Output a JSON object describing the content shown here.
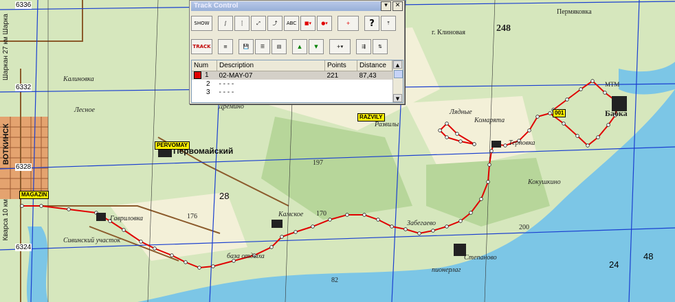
{
  "window": {
    "title": "Track Control",
    "buttons": {
      "show": "SHOW",
      "track": "TRACK",
      "abc": "ABC",
      "help": "?"
    }
  },
  "table": {
    "columns": [
      "Num",
      "Description",
      "Points",
      "Distance"
    ],
    "rows": [
      {
        "num": "1",
        "description": "02-MAY-07",
        "points": "221",
        "distance": "87,43",
        "color": "#e00000"
      },
      {
        "num": "2",
        "description": "- - - -",
        "points": "",
        "distance": ""
      },
      {
        "num": "3",
        "description": "- - - -",
        "points": "",
        "distance": ""
      }
    ]
  },
  "map": {
    "waypoints": {
      "pervomay": "PERVOMAY",
      "magazin": "MAGAZIN",
      "razvily": "RAZVILY",
      "wp001": "001"
    },
    "grid_labels": {
      "g6336": "6336",
      "g6332": "6332",
      "g6328": "6328",
      "g6324": "6324",
      "g28": "28",
      "g24": "24",
      "g48": "48"
    },
    "towns": {
      "pervomaysky": "Первомайский",
      "votkinsk": "ВОТКИНСК",
      "babka": "Бабка",
      "kamskoe": "Камское",
      "dremino": "Дремино",
      "stepanovo": "Степаново",
      "zabegaevo": "Забегаево",
      "gavrilovka": "Гавриловка",
      "klinovaya": "г. Клиновая",
      "permyakovka": "Пермяковка",
      "kokushkino": "Кокушкино",
      "ternovka": "Терновка",
      "komaryata": "Комарята",
      "lyadnye": "Лядные",
      "razvily_town": "Развилы",
      "kalinovka": "Калиновка",
      "lesnoe": "Лесное",
      "sivinsky": "Сивинский участок",
      "pionerlag": "пионерлаг",
      "baza": "база отдыха",
      "mtm": "МТМ",
      "elev248": "248",
      "elev197": "197",
      "elev170": "170",
      "elev176": "176",
      "elev200": "200",
      "elev82": "82"
    },
    "side_text": {
      "left_top": "Шаркан 27 км  Шарка",
      "left_bottom": "Кварса 10 км"
    },
    "track_color": "#e00000"
  }
}
